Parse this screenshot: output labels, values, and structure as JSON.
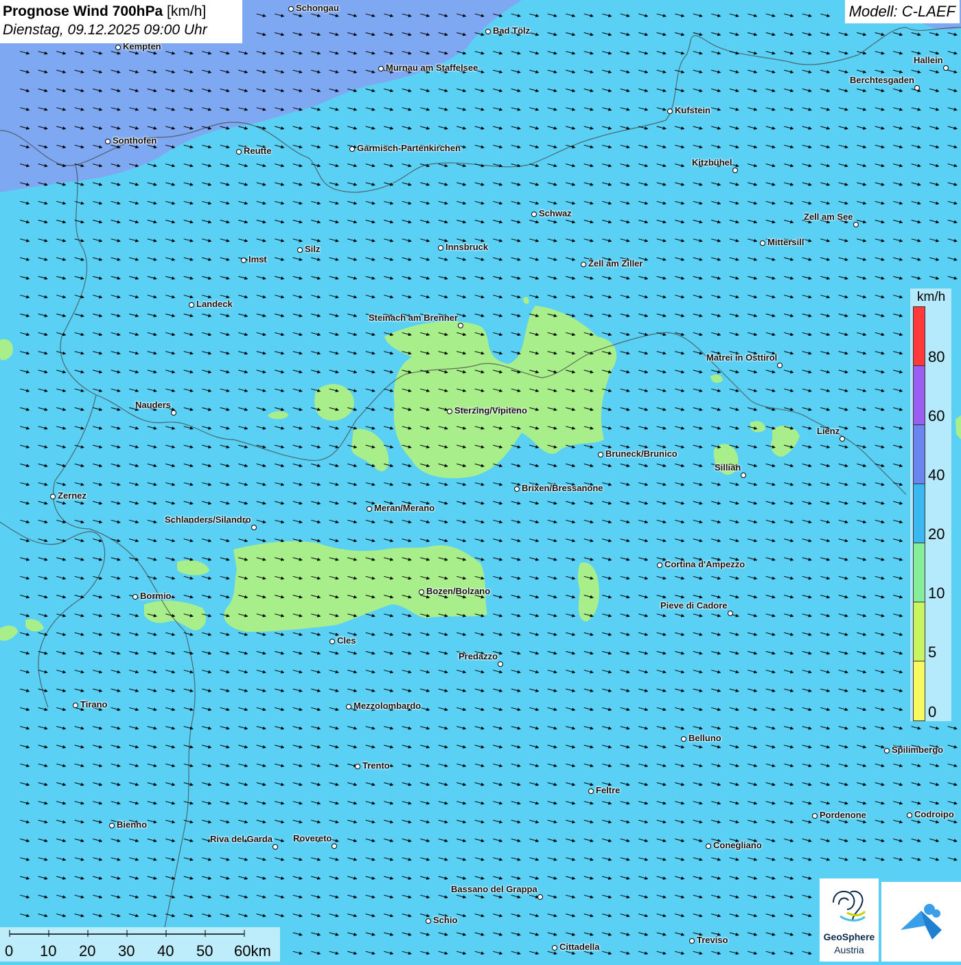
{
  "header": {
    "title": "Prognose Wind 700hPa",
    "unit": "[km/h]",
    "datetime": "Dienstag, 09.12.2025 09:00 Uhr"
  },
  "model": {
    "label": "Modell: C-LAEF"
  },
  "colors": {
    "base_wind_10_20": "#5ad0f5",
    "wind_5_10": "#a8ee8a",
    "wind_20_40": "#7fa8f2",
    "wind_40_60": "#6b85f0",
    "wind_60_80": "#9a5ef0",
    "wind_80_plus": "#ff3a3a",
    "wind_0_5": "#f5f55a",
    "wind_5": "#d6f55a",
    "border": "#444444"
  },
  "legend": {
    "unit": "km/h",
    "labels": [
      "80",
      "60",
      "40",
      "20",
      "10",
      "5",
      "0"
    ]
  },
  "scale": {
    "labels": [
      "0",
      "10",
      "20",
      "30",
      "40",
      "50",
      "60km"
    ]
  },
  "arrows": {
    "direction_deg": 15,
    "icon": "arrow-icon"
  },
  "cities": [
    {
      "name": "Schongau"
    },
    {
      "name": "Bad Tölz"
    },
    {
      "name": "Kempten"
    },
    {
      "name": "Murnau am Staffelsee"
    },
    {
      "name": "Hallein"
    },
    {
      "name": "Berchtesgaden"
    },
    {
      "name": "Kufstein"
    },
    {
      "name": "Sonthofen"
    },
    {
      "name": "Reutte"
    },
    {
      "name": "Garmisch-Partenkirchen"
    },
    {
      "name": "Kitzbühel"
    },
    {
      "name": "Schwaz"
    },
    {
      "name": "Zell am See"
    },
    {
      "name": "Mittersill"
    },
    {
      "name": "Innsbruck"
    },
    {
      "name": "Silz"
    },
    {
      "name": "Imst"
    },
    {
      "name": "Zell am Ziller"
    },
    {
      "name": "Landeck"
    },
    {
      "name": "Steinach am Brenner"
    },
    {
      "name": "Matrei in Osttirol"
    },
    {
      "name": "Nauders"
    },
    {
      "name": "Sterzing/Vipiteno"
    },
    {
      "name": "Lienz"
    },
    {
      "name": "Bruneck/Brunico"
    },
    {
      "name": "Sillian"
    },
    {
      "name": "Zernez"
    },
    {
      "name": "Brixen/Bressanone"
    },
    {
      "name": "Meran/Merano"
    },
    {
      "name": "Schlanders/Silandro"
    },
    {
      "name": "Cortina d'Ampezzo"
    },
    {
      "name": "Bozen/Bolzano"
    },
    {
      "name": "Bormio"
    },
    {
      "name": "Pieve di Cadore"
    },
    {
      "name": "Cles"
    },
    {
      "name": "Predazzo"
    },
    {
      "name": "Tirano"
    },
    {
      "name": "Mezzolombardo"
    },
    {
      "name": "Belluno"
    },
    {
      "name": "Spilimbergo"
    },
    {
      "name": "Trento"
    },
    {
      "name": "Feltre"
    },
    {
      "name": "Bienno"
    },
    {
      "name": "Pordenone"
    },
    {
      "name": "Codroipo"
    },
    {
      "name": "Riva del Garda"
    },
    {
      "name": "Rovereto"
    },
    {
      "name": "Conegliano"
    },
    {
      "name": "Bassano del Grappa"
    },
    {
      "name": "Schio"
    },
    {
      "name": "Treviso"
    },
    {
      "name": "Cittadella"
    }
  ],
  "logos": {
    "geosphere_name": "GeoSphere",
    "geosphere_sub": "Austria"
  }
}
